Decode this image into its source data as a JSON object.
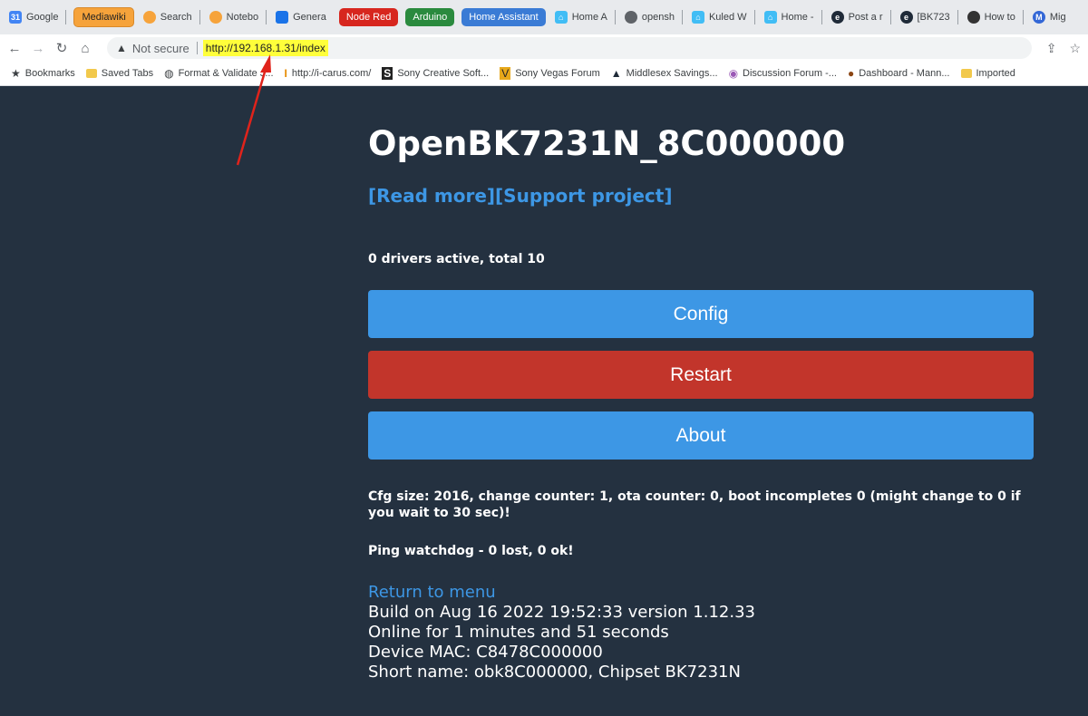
{
  "browser": {
    "tabs": [
      {
        "label": "Google",
        "fav": "calendar-icon"
      },
      {
        "label": "Mediawiki",
        "style": "pill-orange"
      },
      {
        "label": "Search",
        "fav": "grafana-icon"
      },
      {
        "label": "Notebo",
        "fav": "grafana-icon"
      },
      {
        "label": "Genera",
        "fav": "table-icon"
      },
      {
        "label": "Node Red",
        "style": "pill-red"
      },
      {
        "label": "Arduino",
        "style": "pill-green"
      },
      {
        "label": "Home Assistant",
        "style": "pill-blue"
      },
      {
        "label": "Home A",
        "fav": "home-icon"
      },
      {
        "label": "opensh",
        "fav": "globe-icon"
      },
      {
        "label": "Kuled W",
        "fav": "home-icon"
      },
      {
        "label": "Home -",
        "fav": "home-icon"
      },
      {
        "label": "Post a r",
        "fav": "edge-icon"
      },
      {
        "label": "[BK723",
        "fav": "edge-icon"
      },
      {
        "label": "How to",
        "fav": "github-icon"
      },
      {
        "label": "Mig",
        "fav": "m-icon"
      }
    ],
    "security_label": "Not secure",
    "url": "http://192.168.1.31/index",
    "bookmarks_label": "Bookmarks",
    "bookmarks": [
      {
        "label": "Saved Tabs",
        "icon": "folder-icon"
      },
      {
        "label": "Format & Validate J...",
        "icon": "globe-icon"
      },
      {
        "label": "http://i-carus.com/",
        "icon": "icarus-icon"
      },
      {
        "label": "Sony Creative Soft...",
        "icon": "sony-icon"
      },
      {
        "label": "Sony Vegas Forum",
        "icon": "vegas-icon"
      },
      {
        "label": "Middlesex Savings...",
        "icon": "triangle-icon"
      },
      {
        "label": "Discussion Forum -...",
        "icon": "forum-icon"
      },
      {
        "label": "Dashboard - Mann...",
        "icon": "dashboard-icon"
      },
      {
        "label": "Imported",
        "icon": "folder-icon"
      }
    ]
  },
  "device": {
    "title": "OpenBK7231N_8C000000",
    "read_more": "[Read more]",
    "support": "[Support project]",
    "drivers": "0 drivers active, total 10",
    "buttons": {
      "config": "Config",
      "restart": "Restart",
      "about": "About"
    },
    "cfg_status": "Cfg size: 2016, change counter: 1, ota counter: 0, boot incompletes 0 (might change to 0 if you wait to 30 sec)!",
    "ping": "Ping watchdog - 0 lost, 0 ok!",
    "return_link": "Return to menu",
    "build": "Build on Aug 16 2022 19:52:33 version 1.12.33",
    "online": "Online for 1 minutes and 51 seconds",
    "mac": "Device MAC: C8478C000000",
    "short_name": "Short name: obk8C000000, Chipset BK7231N"
  },
  "colors": {
    "page_bg": "#243140",
    "accent": "#3d97e5",
    "danger": "#c2352b",
    "annotation_arrow": "#e0231b",
    "url_highlight": "#ffff3a"
  }
}
